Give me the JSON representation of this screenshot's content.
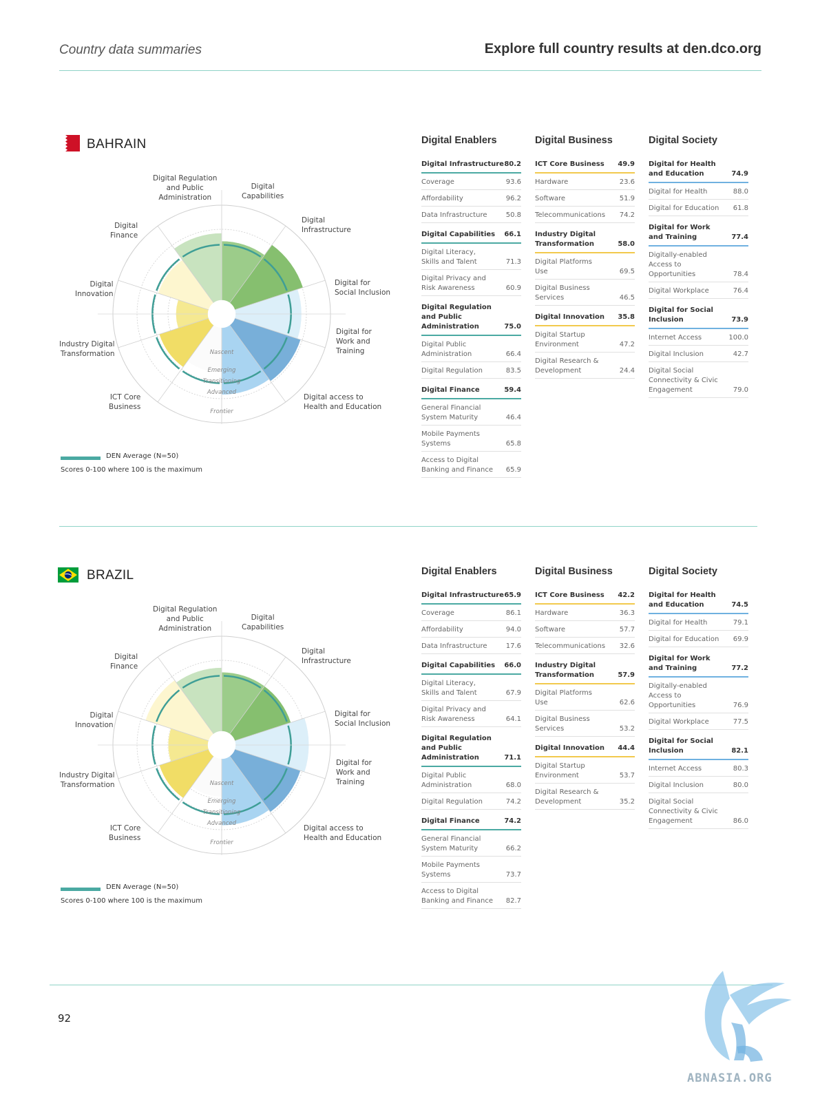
{
  "header": {
    "left": "Country data summaries",
    "right": "Explore full country results at den.dco.org"
  },
  "radar_labels": {
    "reg": "Digital Regulation\nand Public\nAdministration",
    "cap": "Digital\nCapabilities",
    "infra": "Digital\nInfrastructure",
    "social": "Digital for\nSocial Inclusion",
    "work": "Digital for\nWork and\nTraining",
    "health": "Digital access to\nHealth and Education",
    "ict": "ICT Core\nBusiness",
    "industry": "Industry Digital\nTransformation",
    "innovation": "Digital\nInnovation",
    "finance": "Digital\nFinance"
  },
  "stages": [
    "Nascent",
    "Emerging",
    "Transitioning",
    "Advanced",
    "Frontier"
  ],
  "legend": {
    "average": "DEN Average (N=50)",
    "note": "Scores 0-100 where 100 is the maximum"
  },
  "column_titles": {
    "enablers": "Digital Enablers",
    "business": "Digital Business",
    "society": "Digital Society"
  },
  "colors": {
    "enablers": "#4aa9a2",
    "business": "#f2c94c",
    "society": "#6fb1e0",
    "divider": "#8fd3c7"
  },
  "countries": [
    {
      "name": "BAHRAIN",
      "flag": "bahrain",
      "chart_data": {
        "type": "radar-rose",
        "categories": [
          "Digital Capabilities",
          "Digital Infrastructure",
          "Digital for Social Inclusion",
          "Digital for Work and Training",
          "Digital access to Health and Education",
          "ICT Core Business",
          "Industry Digital Transformation",
          "Digital Innovation",
          "Digital Finance",
          "Digital Regulation and Public Administration"
        ],
        "values": [
          66.1,
          80.2,
          73.9,
          77.4,
          74.9,
          49.9,
          58.0,
          35.8,
          59.4,
          75.0
        ],
        "ylim": [
          0,
          100
        ]
      },
      "enablers": [
        {
          "name": "Digital Infrastructure",
          "score": "80.2",
          "items": [
            {
              "name": "Coverage",
              "score": "93.6"
            },
            {
              "name": "Affordability",
              "score": "96.2"
            },
            {
              "name": "Data Infrastructure",
              "score": "50.8"
            }
          ]
        },
        {
          "name": "Digital Capabilities",
          "score": "66.1",
          "items": [
            {
              "name": "Digital Literacy,\nSkills and Talent",
              "score": "71.3"
            },
            {
              "name": "Digital Privacy and\nRisk Awareness",
              "score": "60.9"
            }
          ]
        },
        {
          "name": "Digital Regulation\nand Public\nAdministration",
          "score": "75.0",
          "items": [
            {
              "name": "Digital Public\nAdministration",
              "score": "66.4"
            },
            {
              "name": "Digital Regulation",
              "score": "83.5"
            }
          ]
        },
        {
          "name": "Digital Finance",
          "score": "59.4",
          "items": [
            {
              "name": "General Financial\nSystem Maturity",
              "score": "46.4"
            },
            {
              "name": "Mobile Payments\nSystems",
              "score": "65.8"
            },
            {
              "name": "Access to Digital\nBanking and Finance",
              "score": "65.9"
            }
          ]
        }
      ],
      "business": [
        {
          "name": "ICT Core Business",
          "score": "49.9",
          "items": [
            {
              "name": "Hardware",
              "score": "23.6"
            },
            {
              "name": "Software",
              "score": "51.9"
            },
            {
              "name": "Telecommunications",
              "score": "74.2"
            }
          ]
        },
        {
          "name": "Industry Digital\nTransformation",
          "score": "58.0",
          "items": [
            {
              "name": "Digital Platforms\nUse",
              "score": "69.5"
            },
            {
              "name": "Digital Business\nServices",
              "score": "46.5"
            }
          ]
        },
        {
          "name": "Digital Innovation",
          "score": "35.8",
          "items": [
            {
              "name": "Digital Startup\nEnvironment",
              "score": "47.2"
            },
            {
              "name": "Digital Research &\nDevelopment",
              "score": "24.4"
            }
          ]
        }
      ],
      "society": [
        {
          "name": "Digital for Health\nand Education",
          "score": "74.9",
          "items": [
            {
              "name": "Digital for Health",
              "score": "88.0"
            },
            {
              "name": "Digital for Education",
              "score": "61.8"
            }
          ]
        },
        {
          "name": "Digital for Work\nand Training",
          "score": "77.4",
          "items": [
            {
              "name": "Digitally-enabled\nAccess to\nOpportunities",
              "score": "78.4"
            },
            {
              "name": "Digital Workplace",
              "score": "76.4"
            }
          ]
        },
        {
          "name": "Digital for Social\nInclusion",
          "score": "73.9",
          "items": [
            {
              "name": "Internet Access",
              "score": "100.0"
            },
            {
              "name": "Digital Inclusion",
              "score": "42.7"
            },
            {
              "name": "Digital Social\nConnectivity & Civic\nEngagement",
              "score": "79.0"
            }
          ]
        }
      ]
    },
    {
      "name": "BRAZIL",
      "flag": "brazil",
      "chart_data": {
        "type": "radar-rose",
        "categories": [
          "Digital Capabilities",
          "Digital Infrastructure",
          "Digital for Social Inclusion",
          "Digital for Work and Training",
          "Digital access to Health and Education",
          "ICT Core Business",
          "Industry Digital Transformation",
          "Digital Innovation",
          "Digital Finance",
          "Digital Regulation and Public Administration"
        ],
        "values": [
          66.0,
          65.9,
          82.1,
          77.2,
          74.5,
          42.2,
          57.9,
          44.4,
          74.2,
          71.1
        ],
        "ylim": [
          0,
          100
        ]
      },
      "enablers": [
        {
          "name": "Digital Infrastructure",
          "score": "65.9",
          "items": [
            {
              "name": "Coverage",
              "score": "86.1"
            },
            {
              "name": "Affordability",
              "score": "94.0"
            },
            {
              "name": "Data Infrastructure",
              "score": "17.6"
            }
          ]
        },
        {
          "name": "Digital Capabilities",
          "score": "66.0",
          "items": [
            {
              "name": "Digital Literacy,\nSkills and Talent",
              "score": "67.9"
            },
            {
              "name": "Digital Privacy and\nRisk Awareness",
              "score": "64.1"
            }
          ]
        },
        {
          "name": "Digital Regulation\nand Public\nAdministration",
          "score": "71.1",
          "items": [
            {
              "name": "Digital Public\nAdministration",
              "score": "68.0"
            },
            {
              "name": "Digital Regulation",
              "score": "74.2"
            }
          ]
        },
        {
          "name": "Digital Finance",
          "score": "74.2",
          "items": [
            {
              "name": "General Financial\nSystem Maturity",
              "score": "66.2"
            },
            {
              "name": "Mobile Payments\nSystems",
              "score": "73.7"
            },
            {
              "name": "Access to Digital\nBanking and Finance",
              "score": "82.7"
            }
          ]
        }
      ],
      "business": [
        {
          "name": "ICT Core Business",
          "score": "42.2",
          "items": [
            {
              "name": "Hardware",
              "score": "36.3"
            },
            {
              "name": "Software",
              "score": "57.7"
            },
            {
              "name": "Telecommunications",
              "score": "32.6"
            }
          ]
        },
        {
          "name": "Industry Digital\nTransformation",
          "score": "57.9",
          "items": [
            {
              "name": "Digital Platforms\nUse",
              "score": "62.6"
            },
            {
              "name": "Digital Business\nServices",
              "score": "53.2"
            }
          ]
        },
        {
          "name": "Digital Innovation",
          "score": "44.4",
          "items": [
            {
              "name": "Digital Startup\nEnvironment",
              "score": "53.7"
            },
            {
              "name": "Digital Research &\nDevelopment",
              "score": "35.2"
            }
          ]
        }
      ],
      "society": [
        {
          "name": "Digital for Health\nand Education",
          "score": "74.5",
          "items": [
            {
              "name": "Digital for Health",
              "score": "79.1"
            },
            {
              "name": "Digital for Education",
              "score": "69.9"
            }
          ]
        },
        {
          "name": "Digital for Work\nand Training",
          "score": "77.2",
          "items": [
            {
              "name": "Digitally-enabled\nAccess to\nOpportunities",
              "score": "76.9"
            },
            {
              "name": "Digital Workplace",
              "score": "77.5"
            }
          ]
        },
        {
          "name": "Digital for Social\nInclusion",
          "score": "82.1",
          "items": [
            {
              "name": "Internet Access",
              "score": "80.3"
            },
            {
              "name": "Digital Inclusion",
              "score": "80.0"
            },
            {
              "name": "Digital Social\nConnectivity & Civic\nEngagement",
              "score": "86.0"
            }
          ]
        }
      ]
    }
  ],
  "page_number": "92",
  "watermark": "ABNASIA.ORG"
}
